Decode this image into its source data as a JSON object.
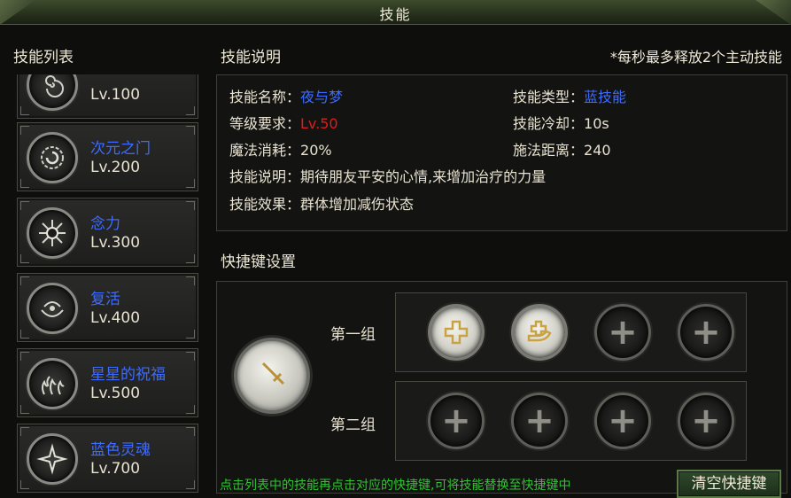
{
  "window": {
    "title": "技能"
  },
  "skill_list": {
    "header": "技能列表",
    "items": [
      {
        "name": "",
        "level": "Lv.100",
        "icon": "spiral-icon"
      },
      {
        "name": "次元之门",
        "level": "Lv.200",
        "icon": "vortex-icon"
      },
      {
        "name": "念力",
        "level": "Lv.300",
        "icon": "spiked-eye-icon"
      },
      {
        "name": "复活",
        "level": "Lv.400",
        "icon": "wreath-icon"
      },
      {
        "name": "星星的祝福",
        "level": "Lv.500",
        "icon": "flames-icon"
      },
      {
        "name": "蓝色灵魂",
        "level": "Lv.700",
        "icon": "star-burst-icon"
      }
    ]
  },
  "description": {
    "header": "技能说明",
    "note": "*每秒最多释放2个主动技能",
    "skill_name_label": "技能名称：",
    "skill_name_value": "夜与梦",
    "skill_type_label": "技能类型：",
    "skill_type_value": "蓝技能",
    "level_req_label": "等级要求：",
    "level_req_value": "Lv.50",
    "cooldown_label": "技能冷却：",
    "cooldown_value": "10s",
    "mana_label": "魔法消耗：",
    "mana_value": "20%",
    "range_label": "施法距离：",
    "range_value": "240",
    "desc_label": "技能说明：",
    "desc_value": "期待朋友平安的心情,来增加治疗的力量",
    "effect_label": "技能效果：",
    "effect_value": "群体增加减伤状态"
  },
  "hotkeys": {
    "header": "快捷键设置",
    "selected_icon": "sword-icon",
    "group1_label": "第一组",
    "group2_label": "第二组",
    "plus": "+",
    "tip": "点击列表中的技能再点击对应的快捷键,可将技能替换至快捷键中",
    "clear_button": "清空快捷键"
  },
  "colors": {
    "skill_name_blue": "#3d6bff",
    "level_red": "#e21a1a",
    "tip_green": "#2ec430"
  }
}
